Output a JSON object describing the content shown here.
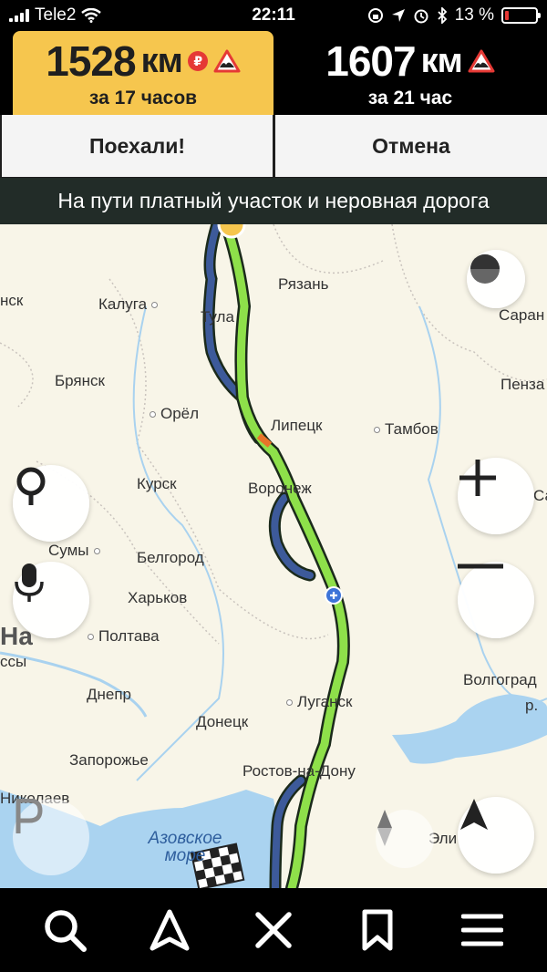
{
  "status_bar": {
    "carrier": "Tele2",
    "time": "22:11",
    "battery_percent": "13 %",
    "battery_level": 0.13,
    "icons": [
      "signal-icon",
      "wifi-icon",
      "rotation-lock-icon",
      "location-arrow-icon",
      "alarm-icon",
      "bluetooth-icon",
      "battery-icon"
    ]
  },
  "routes": [
    {
      "distance": "1528",
      "unit": "км",
      "duration": "за 17 часов",
      "selected": true,
      "icons": [
        "toll-ruble-icon",
        "rough-road-icon"
      ]
    },
    {
      "distance": "1607",
      "unit": "км",
      "duration": "за 21 час",
      "selected": false,
      "icons": [
        "rough-road-icon"
      ]
    }
  ],
  "actions": {
    "go_label": "Поехали!",
    "cancel_label": "Отмена"
  },
  "warning": "На пути платный участок и неровная дорога",
  "map": {
    "cities": {
      "kaluga": "Калуга",
      "ryazan": "Рязань",
      "saransk": "Саран",
      "tula": "Тула",
      "bryansk": "Брянск",
      "penza": "Пенза",
      "orel": "Орёл",
      "lipetsk": "Липецк",
      "tambov": "Тамбов",
      "kursk": "Курск",
      "voronezh": "Воронеж",
      "sumy": "Сумы",
      "belgorod": "Белгород",
      "kharkov": "Харьков",
      "poltava": "Полтава",
      "volgograd": "Волгоград",
      "dnepr": "Днепр",
      "lugansk": "Луганск",
      "donetsk": "Донецк",
      "zaporozhye": "Запорожье",
      "rostov": "Ростов-на-Дону",
      "nikolaev": "Николаев",
      "elista": "Эли",
      "minsk_partial": "нск",
      "na_partial": "На",
      "ssy_partial": "ссы",
      "sa_partial": "Са",
      "r_partial": "р."
    },
    "sea_label": "Азовское море",
    "colors": {
      "main_route": "#8ee04a",
      "alt_route": "#3d5a9a",
      "route_outline": "#1b2a1b",
      "water": "#aad3f0",
      "land": "#f8f5e8",
      "toll_segment": "#e8742a"
    }
  },
  "controls": [
    "compass-icon",
    "search-place-icon",
    "microphone-icon",
    "zoom-in-icon",
    "zoom-out-icon",
    "parking-icon",
    "north-arrow-icon",
    "navigate-arrow-icon"
  ],
  "tabbar": [
    "search-icon",
    "navigation-icon",
    "close-icon",
    "bookmark-icon",
    "menu-icon"
  ]
}
